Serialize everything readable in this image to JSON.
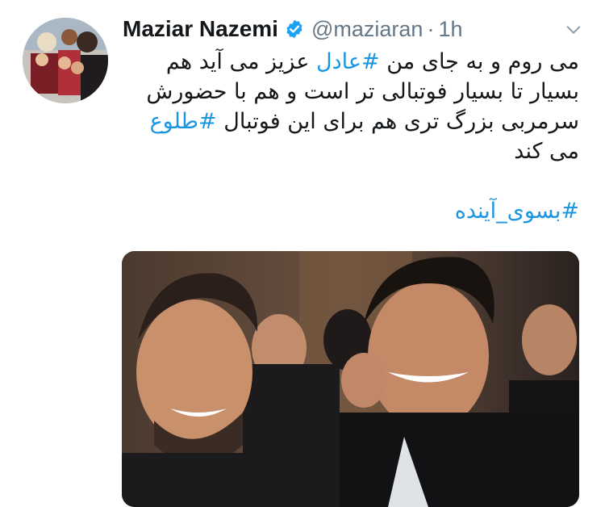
{
  "user": {
    "display_name": "Maziar Nazemi",
    "handle": "@maziaran",
    "separator": "·",
    "time": "1h",
    "verified": true
  },
  "tweet": {
    "lines": [
      "می روم و به جای من ",
      "عادل",
      " عزیز می آید هم",
      "بسیار تا بسیار فوتبالی تر است و هم با حضورش",
      "سرمربی بزرگ تری هم برای این فوتبال ",
      "طلوع",
      "می کند"
    ],
    "hashtag_1": "#عادل",
    "hashtag_2": "#طلوع",
    "hashtag_3": "#بسوی_آینده"
  },
  "icons": {
    "verified_badge": "verified-check-icon",
    "more": "chevron-down-icon"
  },
  "colors": {
    "link": "#1b95e0",
    "verified": "#1da1f2",
    "muted": "#657786",
    "text": "#14171a"
  }
}
